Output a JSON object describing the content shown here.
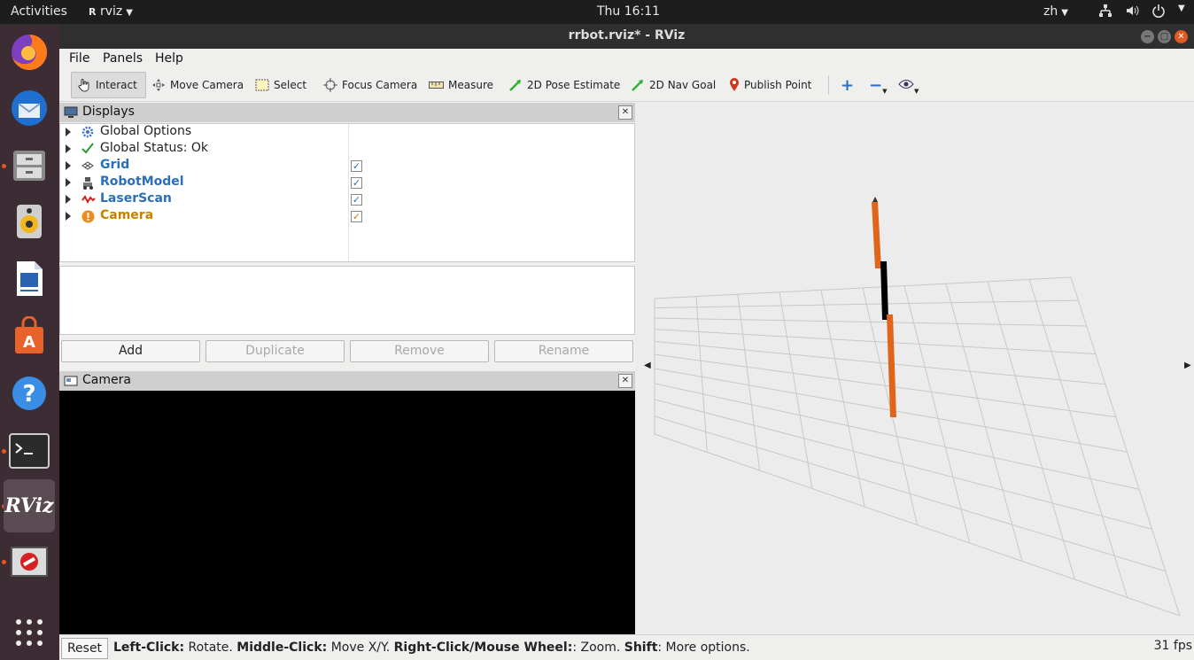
{
  "topbar": {
    "activities": "Activities",
    "app_name": "rviz",
    "clock": "Thu 16:11",
    "lang": "zh"
  },
  "window": {
    "title": "rrbot.rviz* - RViz"
  },
  "menu": {
    "file": "File",
    "panels": "Panels",
    "help": "Help"
  },
  "toolbar": {
    "interact": "Interact",
    "move_camera": "Move Camera",
    "select": "Select",
    "focus_camera": "Focus Camera",
    "measure": "Measure",
    "pose_estimate": "2D Pose Estimate",
    "nav_goal": "2D Nav Goal",
    "publish_point": "Publish Point"
  },
  "displays": {
    "title": "Displays",
    "items": [
      {
        "label": "Global Options",
        "color": "#111111",
        "checked": null,
        "icon": "gear-icon"
      },
      {
        "label": "Global Status: Ok",
        "color": "#111111",
        "checked": null,
        "icon": "check-icon"
      },
      {
        "label": "Grid",
        "color": "#2a6fba",
        "checked": true,
        "icon": "grid-icon"
      },
      {
        "label": "RobotModel",
        "color": "#2a6fba",
        "checked": true,
        "icon": "robot-icon"
      },
      {
        "label": "LaserScan",
        "color": "#2a6fba",
        "checked": true,
        "icon": "laser-icon"
      },
      {
        "label": "Camera",
        "color": "#c77f00",
        "checked": true,
        "icon": "warning-icon"
      }
    ],
    "buttons": {
      "add": "Add",
      "duplicate": "Duplicate",
      "remove": "Remove",
      "rename": "Rename"
    }
  },
  "camera_panel": {
    "title": "Camera"
  },
  "status": {
    "reset": "Reset",
    "b1": "Left-Click:",
    "t1": " Rotate. ",
    "b2": "Middle-Click:",
    "t2": " Move X/Y. ",
    "b3": "Right-Click/Mouse Wheel:",
    "t3": ": Zoom. ",
    "b4": "Shift",
    "t4": ": More options.",
    "fps": "31 fps"
  },
  "colors": {
    "robot_link": "#e0651a",
    "robot_joint": "#000000",
    "grid_line": "#c8c8c8"
  }
}
